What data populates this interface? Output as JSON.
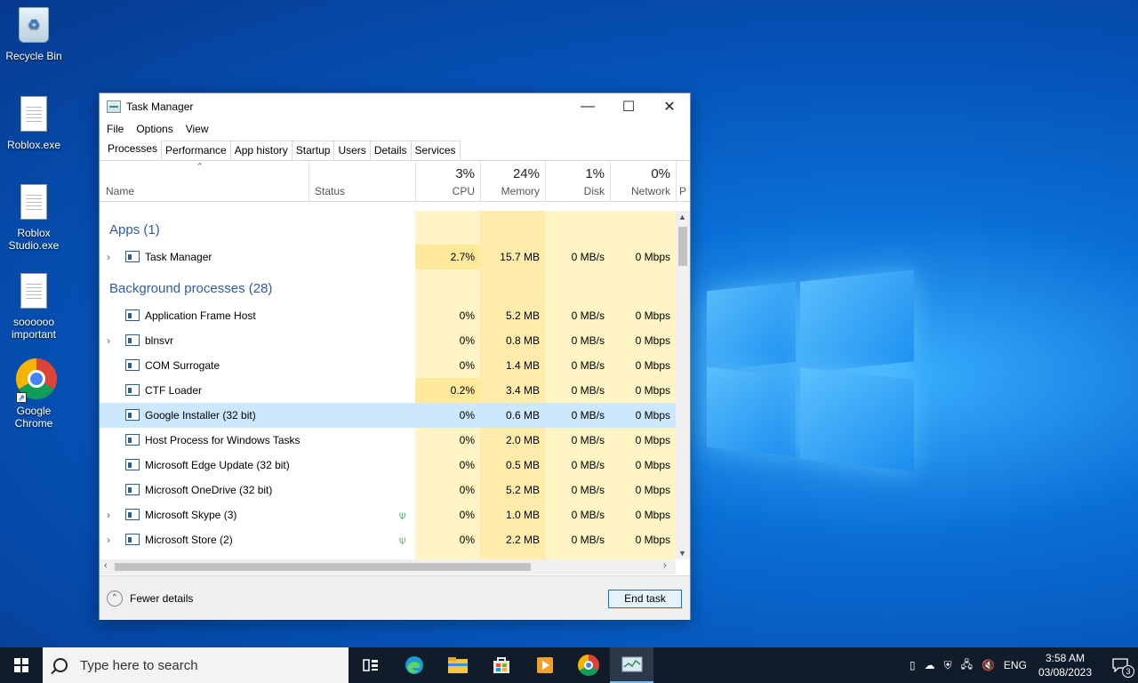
{
  "desktop": {
    "icons": [
      {
        "label": "Recycle Bin"
      },
      {
        "label": "Roblox.exe"
      },
      {
        "label": "Roblox Studio.exe"
      },
      {
        "label": "soooooo important"
      },
      {
        "label": "Google Chrome"
      }
    ]
  },
  "window": {
    "title": "Task Manager",
    "min_glyph": "—",
    "max_glyph": "☐",
    "close_glyph": "✕",
    "menu": [
      "File",
      "Options",
      "View"
    ],
    "tabs": [
      "Processes",
      "Performance",
      "App history",
      "Startup",
      "Users",
      "Details",
      "Services"
    ],
    "active_tab": "Processes"
  },
  "columns": {
    "name": "Name",
    "status": "Status",
    "cpu": {
      "pct": "3%",
      "label": "CPU"
    },
    "memory": {
      "pct": "24%",
      "label": "Memory"
    },
    "disk": {
      "pct": "1%",
      "label": "Disk"
    },
    "network": {
      "pct": "0%",
      "label": "Network"
    },
    "extra": "P"
  },
  "groups": {
    "apps": "Apps (1)",
    "background": "Background processes (28)"
  },
  "apps": [
    {
      "name": "Task Manager",
      "cpu": "2.7%",
      "memory": "15.7 MB",
      "disk": "0 MB/s",
      "network": "0 Mbps",
      "expandable": true
    }
  ],
  "background": [
    {
      "name": "Application Frame Host",
      "cpu": "0%",
      "memory": "5.2 MB",
      "disk": "0 MB/s",
      "network": "0 Mbps"
    },
    {
      "name": "blnsvr",
      "cpu": "0%",
      "memory": "0.8 MB",
      "disk": "0 MB/s",
      "network": "0 Mbps",
      "expandable": true
    },
    {
      "name": "COM Surrogate",
      "cpu": "0%",
      "memory": "1.4 MB",
      "disk": "0 MB/s",
      "network": "0 Mbps"
    },
    {
      "name": "CTF Loader",
      "cpu": "0.2%",
      "memory": "3.4 MB",
      "disk": "0 MB/s",
      "network": "0 Mbps"
    },
    {
      "name": "Google Installer (32 bit)",
      "cpu": "0%",
      "memory": "0.6 MB",
      "disk": "0 MB/s",
      "network": "0 Mbps",
      "selected": true
    },
    {
      "name": "Host Process for Windows Tasks",
      "cpu": "0%",
      "memory": "2.0 MB",
      "disk": "0 MB/s",
      "network": "0 Mbps"
    },
    {
      "name": "Microsoft Edge Update (32 bit)",
      "cpu": "0%",
      "memory": "0.5 MB",
      "disk": "0 MB/s",
      "network": "0 Mbps"
    },
    {
      "name": "Microsoft OneDrive (32 bit)",
      "cpu": "0%",
      "memory": "5.2 MB",
      "disk": "0 MB/s",
      "network": "0 Mbps"
    },
    {
      "name": "Microsoft Skype (3)",
      "cpu": "0%",
      "memory": "1.0 MB",
      "disk": "0 MB/s",
      "network": "0 Mbps",
      "expandable": true,
      "suspended": true
    },
    {
      "name": "Microsoft Store (2)",
      "cpu": "0%",
      "memory": "2.2 MB",
      "disk": "0 MB/s",
      "network": "0 Mbps",
      "expandable": true,
      "suspended": true
    }
  ],
  "footer": {
    "fewer_details": "Fewer details",
    "end_task": "End task"
  },
  "taskbar": {
    "search_placeholder": "Type here to search",
    "pinned": [
      "task-view-icon",
      "edge-icon",
      "file-explorer-icon",
      "store-icon",
      "media-player-icon",
      "chrome-icon",
      "task-manager-icon"
    ],
    "language": "ENG",
    "time": "3:58 AM",
    "date": "03/08/2023",
    "notification_count": "3"
  },
  "colors": {
    "heat_light": "#fff4c4",
    "heat_medium": "#ffecaa",
    "selection": "#cce8ff",
    "group_text": "#2e5d9c",
    "taskbar": "#101c2a"
  }
}
